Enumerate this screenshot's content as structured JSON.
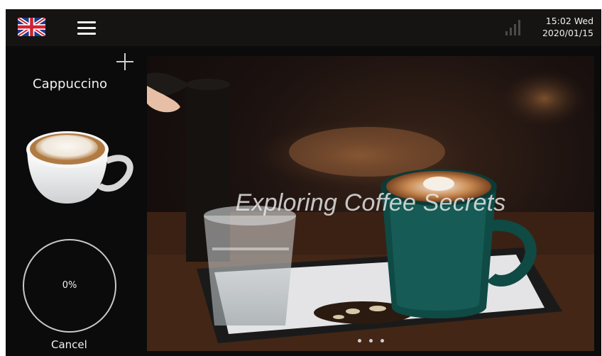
{
  "topbar": {
    "language_icon": "uk-flag-icon",
    "menu_icon": "hamburger-menu-icon",
    "signal_icon": "signal-strength-icon",
    "time_day": "15:02 Wed",
    "date": "2020/01/15"
  },
  "sidebar": {
    "add_icon": "plus-icon",
    "drink_name": "Cappuccino",
    "drink_image": "cappuccino-cup",
    "progress_label": "0%",
    "progress_value": 0,
    "cancel_label": "Cancel"
  },
  "main": {
    "video_title": "Exploring Coffee Secrets",
    "carousel_pages": 3
  },
  "colors": {
    "background": "#0b0b0b",
    "topbar": "#161412",
    "text": "#f2f2f2",
    "ring": "#c8c8c8"
  }
}
